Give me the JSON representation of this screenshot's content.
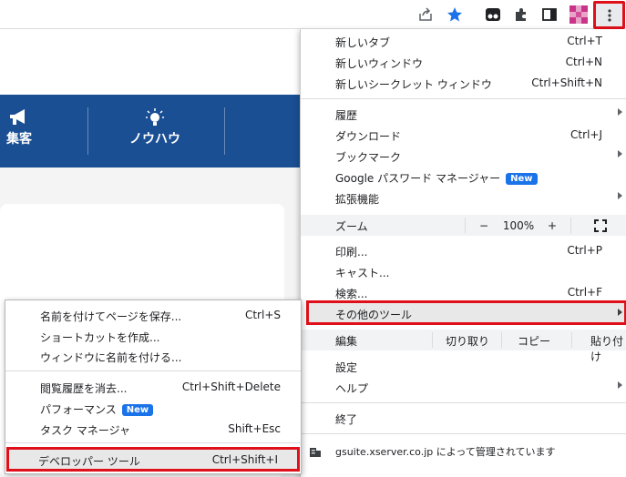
{
  "toolbar": {
    "icons": [
      "share-icon",
      "bookmark-star-icon",
      "tampermonkey-icon",
      "extensions-puzzle-icon",
      "side-panel-icon",
      "profile-avatar",
      "kebab-menu-icon"
    ],
    "accent_color": "#1a73e8",
    "highlight_color": "#e0101a"
  },
  "page": {
    "nav": [
      {
        "label": "集客",
        "icon": "megaphone-icon"
      },
      {
        "label": "ノウハウ",
        "icon": "lightbulb-icon"
      }
    ],
    "nav_color": "#1a4f94"
  },
  "menu": {
    "new_tab": {
      "label": "新しいタブ",
      "shortcut": "Ctrl+T"
    },
    "new_window": {
      "label": "新しいウィンドウ",
      "shortcut": "Ctrl+N"
    },
    "new_incognito": {
      "label": "新しいシークレット ウィンドウ",
      "shortcut": "Ctrl+Shift+N"
    },
    "history": {
      "label": "履歴"
    },
    "downloads": {
      "label": "ダウンロード",
      "shortcut": "Ctrl+J"
    },
    "bookmarks": {
      "label": "ブックマーク"
    },
    "password_manager": {
      "label": "Google パスワード マネージャー",
      "badge": "New"
    },
    "extensions": {
      "label": "拡張機能"
    },
    "zoom": {
      "label": "ズーム",
      "minus": "−",
      "value": "100%",
      "plus": "+"
    },
    "print": {
      "label": "印刷...",
      "shortcut": "Ctrl+P"
    },
    "cast": {
      "label": "キャスト..."
    },
    "find": {
      "label": "検索...",
      "shortcut": "Ctrl+F"
    },
    "more_tools": {
      "label": "その他のツール"
    },
    "edit": {
      "label": "編集",
      "cut": "切り取り",
      "copy": "コピー",
      "paste": "貼り付け"
    },
    "settings": {
      "label": "設定"
    },
    "help": {
      "label": "ヘルプ"
    },
    "exit": {
      "label": "終了"
    },
    "managed": {
      "label": "gsuite.xserver.co.jp によって管理されています"
    }
  },
  "submenu": {
    "save_page": {
      "label": "名前を付けてページを保存...",
      "shortcut": "Ctrl+S"
    },
    "create_shortcut": {
      "label": "ショートカットを作成..."
    },
    "name_window": {
      "label": "ウィンドウに名前を付ける..."
    },
    "clear_data": {
      "label": "閲覧履歴を消去...",
      "shortcut": "Ctrl+Shift+Delete"
    },
    "performance": {
      "label": "パフォーマンス",
      "badge": "New"
    },
    "task_manager": {
      "label": "タスク マネージャ",
      "shortcut": "Shift+Esc"
    },
    "developer_tools": {
      "label": "デベロッパー ツール",
      "shortcut": "Ctrl+Shift+I"
    }
  }
}
